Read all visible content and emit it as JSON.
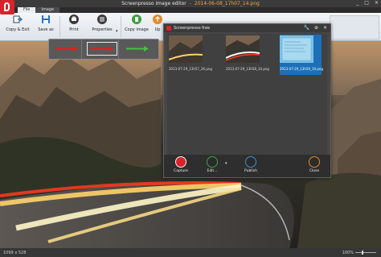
{
  "window": {
    "title_app": "Screenpresso image editor",
    "title_file": "2014-06-08_17h07_14.png",
    "separator": "-",
    "buttons": [
      "_",
      "□",
      "✕"
    ]
  },
  "ribbon": {
    "tabs": [
      {
        "label": "File"
      },
      {
        "label": "Image"
      }
    ],
    "buttons": {
      "copy_exit": "Copy & Exit",
      "save_as": "Save as",
      "print": "Print",
      "properties": "Properties",
      "copy_image": "Copy image",
      "upload": "Up"
    }
  },
  "arrow_styles": [
    {
      "color": "#e02020"
    },
    {
      "color": "#e02020"
    },
    {
      "color": "#3ec43e"
    }
  ],
  "panel": {
    "title": "Screenpresso free",
    "header_icons": [
      "wrench-icon",
      "pin-icon",
      "close-icon"
    ],
    "thumbnails": [
      {
        "caption": "2013-07-29_13h57_26.png",
        "selected": false
      },
      {
        "caption": "2013-07-29_13h58_34.png",
        "selected": false
      },
      {
        "caption": "2013-07-29_13h59_10.png",
        "selected": true
      }
    ],
    "actions": {
      "capture": "Capture",
      "edit": "Edit...",
      "publish": "Publish",
      "close": "Close"
    }
  },
  "status": {
    "dimensions": "1099 x 528",
    "zoom": "100%"
  }
}
